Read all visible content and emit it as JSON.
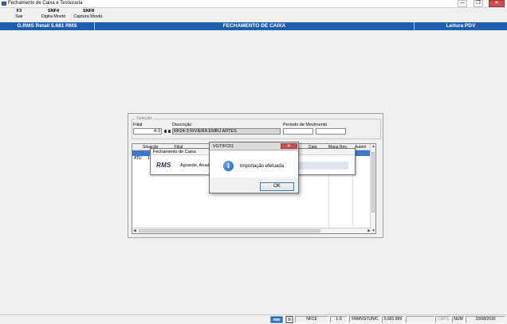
{
  "window": {
    "title": "Fechamento de Caixa e Tesouraria",
    "minimize_glyph": "—",
    "restore_glyph": "❐",
    "close_glyph": "✕"
  },
  "fkeys": [
    {
      "key": "F3",
      "label": "Sair"
    },
    {
      "key": "SNF4",
      "label": "Digita Movto"
    },
    {
      "key": "SNF8",
      "label": "Captura Movto."
    }
  ],
  "header": {
    "left": "G.RMS Retail 5.681 RMS",
    "center": "FECHAMENTO DE CAIXA",
    "right": "Leitura PDV"
  },
  "selection": {
    "legend": "Seleção",
    "filial_label": "Filial",
    "filial_value": "4-3",
    "descricao_label": "Descrição",
    "descricao_value": "RK04-3 RIVIERA EMBU ARTES",
    "periodo_label": "Período de Movimento",
    "periodo_from": "",
    "periodo_to": ""
  },
  "grid": {
    "columns": [
      "Situação",
      "Filial",
      "Data",
      "Mapa Res.",
      "Autom"
    ],
    "rows": [
      {
        "situacao": "ATU",
        "filial": "1"
      }
    ]
  },
  "progress_window": {
    "title": "Fechamento de Caixa",
    "logo": "RMS",
    "text": "Aguarde, Atuali"
  },
  "message_box": {
    "title": "VGTIFC01",
    "icon": "info-icon",
    "message": "Importação efetuada",
    "ok_label": "OK"
  },
  "statusbar": {
    "mode": "NFCE",
    "session": "1-9",
    "program": "FRMVGTUNIC",
    "version": "5.681.999",
    "caps": "CAPS",
    "num": "NUM",
    "date": "15/08/2016"
  },
  "colors": {
    "header_blue": "#1d5fae",
    "close_red": "#c75050"
  }
}
